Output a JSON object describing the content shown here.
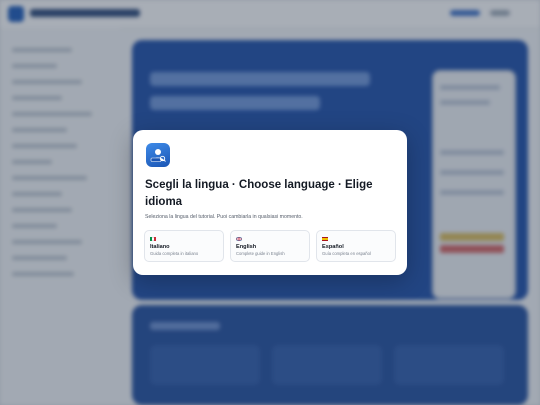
{
  "modal": {
    "title": "Scegli la lingua · Choose language · Elige idioma",
    "subtitle": "Seleziona la lingua del tutorial. Puoi cambiarla in qualsiasi momento.",
    "icon": "app-logo-icon",
    "options": [
      {
        "name": "Italiano",
        "desc": "Guida completa in italiano",
        "flag": "flag-it-icon",
        "colors": [
          "#009246",
          "#ffffff",
          "#ce2b37"
        ]
      },
      {
        "name": "English",
        "desc": "Complete guide in English",
        "flag": "flag-uk-icon",
        "colors": [
          "#012169",
          "#ffffff",
          "#c8102e"
        ]
      },
      {
        "name": "Español",
        "desc": "Guía completa en español",
        "flag": "flag-es-icon",
        "colors": [
          "#aa151b",
          "#f1bf00",
          "#aa151b"
        ]
      }
    ]
  },
  "colors": {
    "accent": "#1a55b4",
    "hero_background": "#1f4fa8",
    "overlay": "rgba(40,52,72,0.38)"
  }
}
